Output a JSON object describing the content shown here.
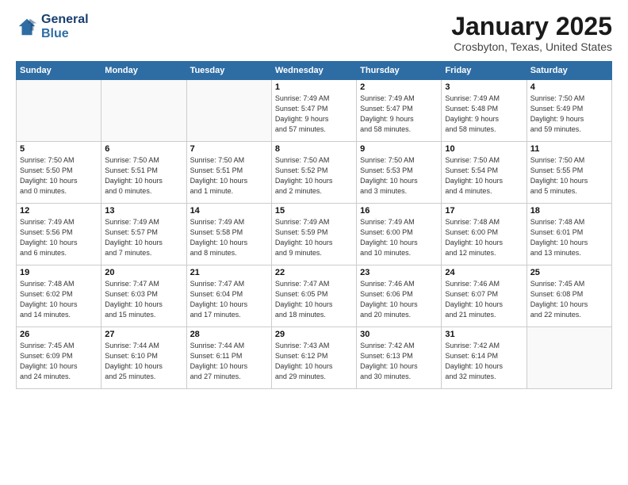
{
  "header": {
    "logo_line1": "General",
    "logo_line2": "Blue",
    "title": "January 2025",
    "subtitle": "Crosbyton, Texas, United States"
  },
  "weekdays": [
    "Sunday",
    "Monday",
    "Tuesday",
    "Wednesday",
    "Thursday",
    "Friday",
    "Saturday"
  ],
  "weeks": [
    [
      {
        "day": "",
        "info": ""
      },
      {
        "day": "",
        "info": ""
      },
      {
        "day": "",
        "info": ""
      },
      {
        "day": "1",
        "info": "Sunrise: 7:49 AM\nSunset: 5:47 PM\nDaylight: 9 hours\nand 57 minutes."
      },
      {
        "day": "2",
        "info": "Sunrise: 7:49 AM\nSunset: 5:47 PM\nDaylight: 9 hours\nand 58 minutes."
      },
      {
        "day": "3",
        "info": "Sunrise: 7:49 AM\nSunset: 5:48 PM\nDaylight: 9 hours\nand 58 minutes."
      },
      {
        "day": "4",
        "info": "Sunrise: 7:50 AM\nSunset: 5:49 PM\nDaylight: 9 hours\nand 59 minutes."
      }
    ],
    [
      {
        "day": "5",
        "info": "Sunrise: 7:50 AM\nSunset: 5:50 PM\nDaylight: 10 hours\nand 0 minutes."
      },
      {
        "day": "6",
        "info": "Sunrise: 7:50 AM\nSunset: 5:51 PM\nDaylight: 10 hours\nand 0 minutes."
      },
      {
        "day": "7",
        "info": "Sunrise: 7:50 AM\nSunset: 5:51 PM\nDaylight: 10 hours\nand 1 minute."
      },
      {
        "day": "8",
        "info": "Sunrise: 7:50 AM\nSunset: 5:52 PM\nDaylight: 10 hours\nand 2 minutes."
      },
      {
        "day": "9",
        "info": "Sunrise: 7:50 AM\nSunset: 5:53 PM\nDaylight: 10 hours\nand 3 minutes."
      },
      {
        "day": "10",
        "info": "Sunrise: 7:50 AM\nSunset: 5:54 PM\nDaylight: 10 hours\nand 4 minutes."
      },
      {
        "day": "11",
        "info": "Sunrise: 7:50 AM\nSunset: 5:55 PM\nDaylight: 10 hours\nand 5 minutes."
      }
    ],
    [
      {
        "day": "12",
        "info": "Sunrise: 7:49 AM\nSunset: 5:56 PM\nDaylight: 10 hours\nand 6 minutes."
      },
      {
        "day": "13",
        "info": "Sunrise: 7:49 AM\nSunset: 5:57 PM\nDaylight: 10 hours\nand 7 minutes."
      },
      {
        "day": "14",
        "info": "Sunrise: 7:49 AM\nSunset: 5:58 PM\nDaylight: 10 hours\nand 8 minutes."
      },
      {
        "day": "15",
        "info": "Sunrise: 7:49 AM\nSunset: 5:59 PM\nDaylight: 10 hours\nand 9 minutes."
      },
      {
        "day": "16",
        "info": "Sunrise: 7:49 AM\nSunset: 6:00 PM\nDaylight: 10 hours\nand 10 minutes."
      },
      {
        "day": "17",
        "info": "Sunrise: 7:48 AM\nSunset: 6:00 PM\nDaylight: 10 hours\nand 12 minutes."
      },
      {
        "day": "18",
        "info": "Sunrise: 7:48 AM\nSunset: 6:01 PM\nDaylight: 10 hours\nand 13 minutes."
      }
    ],
    [
      {
        "day": "19",
        "info": "Sunrise: 7:48 AM\nSunset: 6:02 PM\nDaylight: 10 hours\nand 14 minutes."
      },
      {
        "day": "20",
        "info": "Sunrise: 7:47 AM\nSunset: 6:03 PM\nDaylight: 10 hours\nand 15 minutes."
      },
      {
        "day": "21",
        "info": "Sunrise: 7:47 AM\nSunset: 6:04 PM\nDaylight: 10 hours\nand 17 minutes."
      },
      {
        "day": "22",
        "info": "Sunrise: 7:47 AM\nSunset: 6:05 PM\nDaylight: 10 hours\nand 18 minutes."
      },
      {
        "day": "23",
        "info": "Sunrise: 7:46 AM\nSunset: 6:06 PM\nDaylight: 10 hours\nand 20 minutes."
      },
      {
        "day": "24",
        "info": "Sunrise: 7:46 AM\nSunset: 6:07 PM\nDaylight: 10 hours\nand 21 minutes."
      },
      {
        "day": "25",
        "info": "Sunrise: 7:45 AM\nSunset: 6:08 PM\nDaylight: 10 hours\nand 22 minutes."
      }
    ],
    [
      {
        "day": "26",
        "info": "Sunrise: 7:45 AM\nSunset: 6:09 PM\nDaylight: 10 hours\nand 24 minutes."
      },
      {
        "day": "27",
        "info": "Sunrise: 7:44 AM\nSunset: 6:10 PM\nDaylight: 10 hours\nand 25 minutes."
      },
      {
        "day": "28",
        "info": "Sunrise: 7:44 AM\nSunset: 6:11 PM\nDaylight: 10 hours\nand 27 minutes."
      },
      {
        "day": "29",
        "info": "Sunrise: 7:43 AM\nSunset: 6:12 PM\nDaylight: 10 hours\nand 29 minutes."
      },
      {
        "day": "30",
        "info": "Sunrise: 7:42 AM\nSunset: 6:13 PM\nDaylight: 10 hours\nand 30 minutes."
      },
      {
        "day": "31",
        "info": "Sunrise: 7:42 AM\nSunset: 6:14 PM\nDaylight: 10 hours\nand 32 minutes."
      },
      {
        "day": "",
        "info": ""
      }
    ]
  ]
}
